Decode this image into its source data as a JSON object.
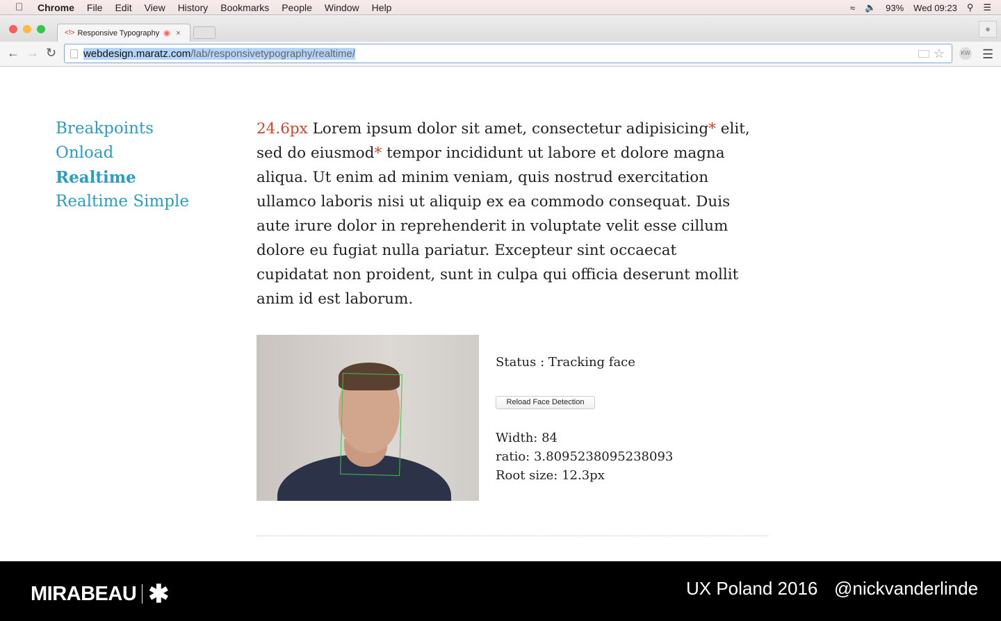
{
  "menubar": {
    "app": "Chrome",
    "items": [
      "File",
      "Edit",
      "View",
      "History",
      "Bookmarks",
      "People",
      "Window",
      "Help"
    ],
    "battery": "93%",
    "clock": "Wed 09:23"
  },
  "browser": {
    "tab_title": "Responsive Typography",
    "url_host": "webdesign.maratz.com",
    "url_path": "/lab/responsivetypography/realtime/"
  },
  "sidebar": {
    "items": [
      {
        "label": "Breakpoints"
      },
      {
        "label": "Onload"
      },
      {
        "label": "Realtime",
        "active": true
      },
      {
        "label": "Realtime Simple"
      }
    ]
  },
  "content": {
    "font_size_label": "24.6px",
    "line1": " Lorem ipsum dolor sit amet, consectetur adipisicing",
    "line1_end": " elit,",
    "line2_start": "sed do eiusmod",
    "line2_end": " tempor incididunt ut labore et dolore magna",
    "asterisk": "*",
    "lines": [
      "aliqua. Ut enim ad minim veniam, quis nostrud exercitation",
      "ullamco laboris nisi ut aliquip ex ea commodo consequat. Duis",
      "aute irure dolor in reprehenderit in voluptate velit esse cillum",
      "dolore eu fugiat nulla pariatur. Excepteur sint occaecat",
      "cupidatat non proident, sunt in culpa qui officia deserunt mollit",
      "anim id est laborum."
    ],
    "accent_color": "#d4412a"
  },
  "tracker": {
    "status": "Status : Tracking face",
    "reload_label": "Reload Face Detection",
    "width": "Width: 84",
    "ratio": "ratio: 3.8095238095238093",
    "root_size": "Root size: 12.3px"
  },
  "footer": {
    "logo": "MIRABEAU",
    "event": "UX Poland 2016",
    "handle": "@nickvanderlinde"
  }
}
